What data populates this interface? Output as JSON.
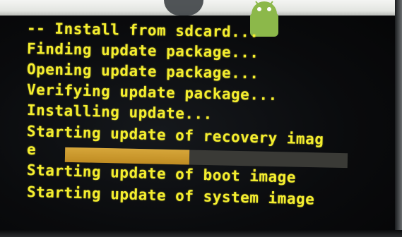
{
  "recovery_log": {
    "lines": [
      "-- Install from sdcard...",
      "Finding update package...",
      "Opening update package...",
      "Verifying update package...",
      "Installing update...",
      "Starting update of recovery imag",
      "e",
      "Starting update of boot image",
      "Starting update of system image"
    ]
  },
  "progress": {
    "fraction": 0.44
  },
  "colors": {
    "text": "#f4ee2e",
    "progress_fill": "#c9952b",
    "progress_track": "#3a3a36",
    "background": "#07080a"
  }
}
